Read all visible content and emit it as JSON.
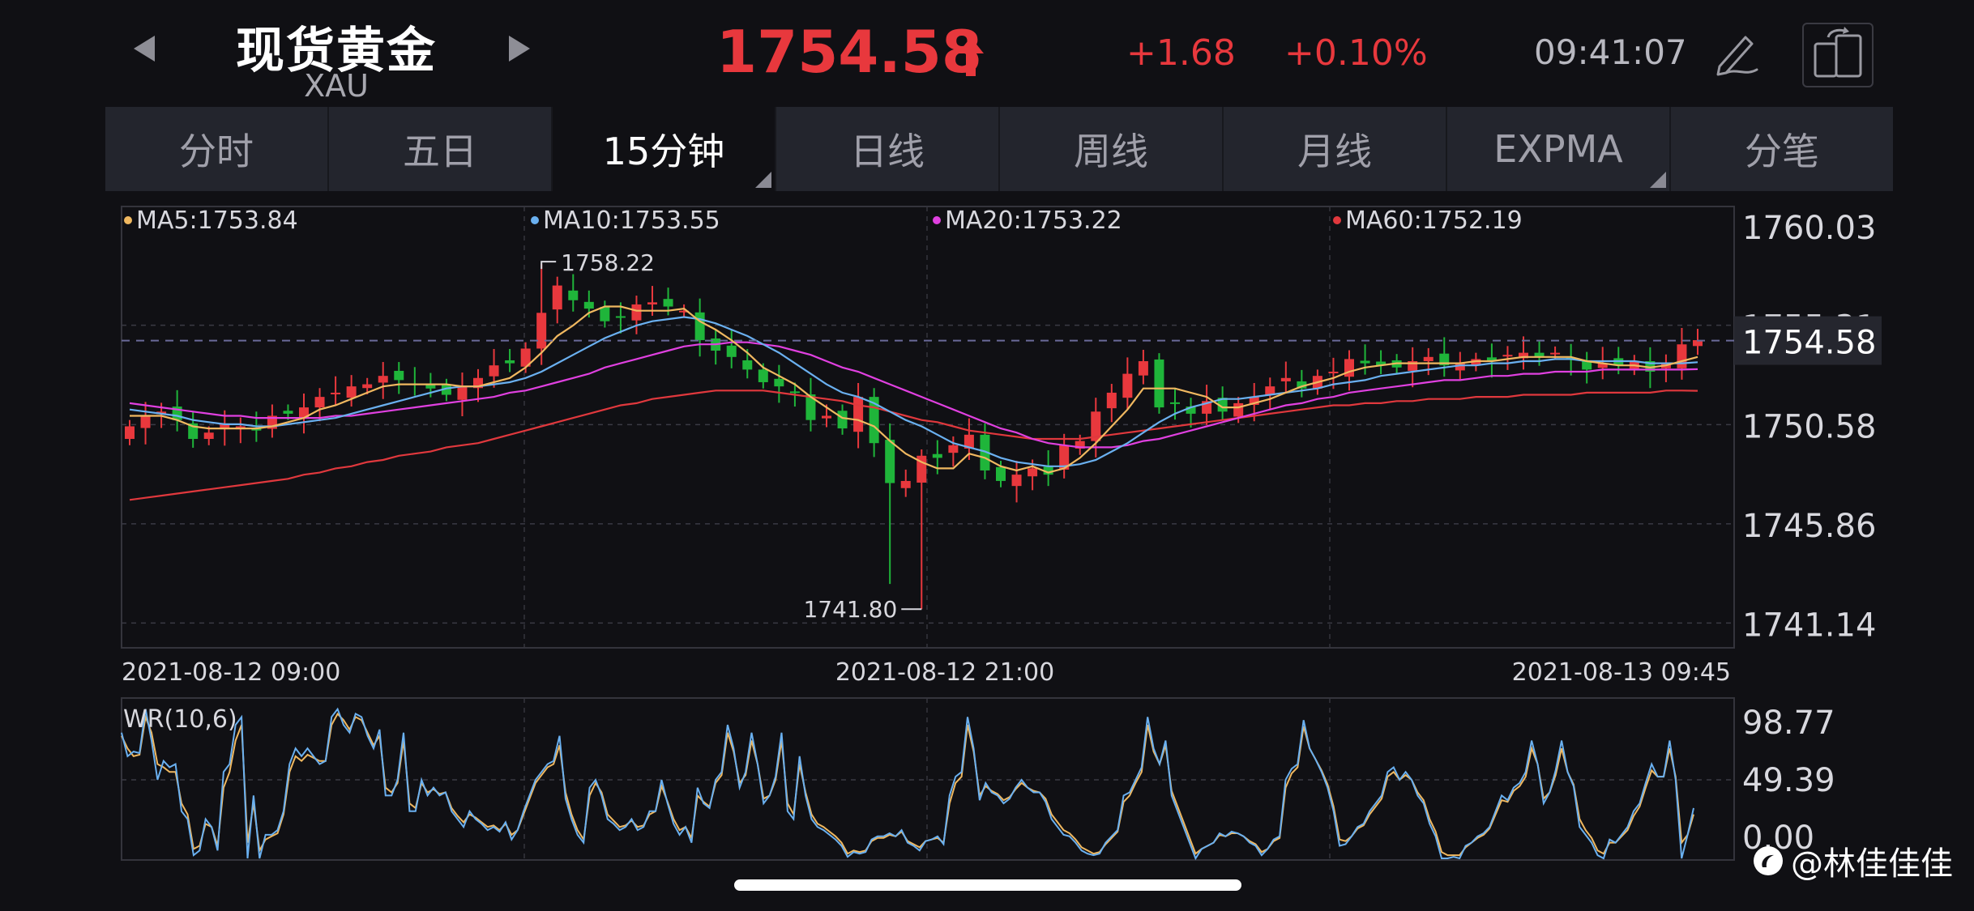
{
  "header": {
    "title": "现货黄金",
    "subtitle": "XAU",
    "price": "1754.58",
    "change": "+1.68",
    "change_pct": "+0.10%",
    "time": "09:41:07"
  },
  "tabs": [
    {
      "label": "分时",
      "active": false,
      "corner": false
    },
    {
      "label": "五日",
      "active": false,
      "corner": false
    },
    {
      "label": "15分钟",
      "active": true,
      "corner": true
    },
    {
      "label": "日线",
      "active": false,
      "corner": false
    },
    {
      "label": "周线",
      "active": false,
      "corner": false
    },
    {
      "label": "月线",
      "active": false,
      "corner": false
    },
    {
      "label": "EXPMA",
      "active": false,
      "corner": true
    },
    {
      "label": "分笔",
      "active": false,
      "corner": false
    }
  ],
  "colors": {
    "up": "#e8383d",
    "down": "#1fb53a",
    "ma5": "#f0b860",
    "ma10": "#6ab0f0",
    "ma20": "#e040e0",
    "ma60": "#e0383d",
    "wr1": "#6ab0f0",
    "wr2": "#f0b860"
  },
  "watermark": "@林佳佳佳",
  "chart_data": [
    {
      "type": "candlestick",
      "legend": [
        {
          "label": "MA5:1753.84",
          "color_key": "ma5"
        },
        {
          "label": "MA10:1753.55",
          "color_key": "ma10"
        },
        {
          "label": "MA20:1753.22",
          "color_key": "ma20"
        },
        {
          "label": "MA60:1752.19",
          "color_key": "ma60"
        }
      ],
      "y_ticks": [
        "1760.03",
        "1755.31",
        "1750.58",
        "1745.86",
        "1741.14"
      ],
      "ylim": [
        1741.14,
        1760.03
      ],
      "current_price_label": "1754.58",
      "current_price": 1754.58,
      "x_labels": [
        "2021-08-12 09:00",
        "2021-08-12 21:00",
        "2021-08-13 09:45"
      ],
      "annotations": [
        {
          "label": "1758.22",
          "value": 1758.22,
          "index": 26
        },
        {
          "label": "1741.80",
          "value": 1741.8,
          "index": 50
        }
      ],
      "series_close": [
        1750.5,
        1751.0,
        1751.2,
        1750.8,
        1749.9,
        1750.2,
        1750.6,
        1750.5,
        1750.3,
        1751.0,
        1751.1,
        1751.4,
        1751.9,
        1752.1,
        1752.4,
        1752.5,
        1752.9,
        1752.7,
        1752.5,
        1752.3,
        1752.0,
        1752.4,
        1752.8,
        1753.4,
        1753.5,
        1754.2,
        1755.9,
        1757.2,
        1756.5,
        1756.1,
        1755.5,
        1755.7,
        1756.3,
        1756.4,
        1756.2,
        1756.0,
        1754.6,
        1754.1,
        1753.8,
        1753.2,
        1752.6,
        1752.4,
        1752.1,
        1750.8,
        1751.0,
        1750.4,
        1751.9,
        1749.7,
        1747.8,
        1747.9,
        1749.1,
        1749.0,
        1749.6,
        1750.1,
        1748.4,
        1747.9,
        1748.2,
        1748.5,
        1748.2,
        1749.6,
        1749.8,
        1751.2,
        1752.1,
        1753.0,
        1753.6,
        1751.4,
        1751.6,
        1751.1,
        1751.7,
        1751.2,
        1751.6,
        1751.9,
        1752.4,
        1752.8,
        1752.3,
        1752.9,
        1753.1,
        1753.7,
        1753.5,
        1753.4,
        1753.3,
        1753.6,
        1753.8,
        1753.4,
        1753.5,
        1753.7,
        1753.6,
        1753.9,
        1754.0,
        1753.8,
        1754.0,
        1753.7,
        1753.2,
        1753.5,
        1753.4,
        1753.6,
        1753.1,
        1753.5,
        1754.4,
        1754.6
      ],
      "series_ma5": [
        1751.0,
        1751.0,
        1751.0,
        1750.8,
        1750.5,
        1750.4,
        1750.4,
        1750.4,
        1750.4,
        1750.5,
        1750.7,
        1750.9,
        1751.3,
        1751.5,
        1751.8,
        1752.1,
        1752.4,
        1752.5,
        1752.5,
        1752.5,
        1752.5,
        1752.4,
        1752.4,
        1752.6,
        1752.8,
        1753.3,
        1754.0,
        1754.8,
        1755.3,
        1755.9,
        1756.2,
        1756.2,
        1756.0,
        1756.0,
        1756.0,
        1756.1,
        1755.5,
        1755.1,
        1754.6,
        1754.0,
        1753.3,
        1752.9,
        1752.5,
        1751.9,
        1751.4,
        1750.9,
        1750.8,
        1750.5,
        1749.8,
        1749.2,
        1748.8,
        1748.5,
        1748.5,
        1749.2,
        1749.0,
        1748.6,
        1748.4,
        1748.6,
        1748.3,
        1748.5,
        1749.0,
        1749.7,
        1750.5,
        1751.3,
        1752.3,
        1752.3,
        1752.3,
        1752.1,
        1751.9,
        1751.4,
        1751.4,
        1751.6,
        1751.8,
        1752.1,
        1752.4,
        1752.6,
        1752.8,
        1753.1,
        1753.3,
        1753.4,
        1753.5,
        1753.5,
        1753.5,
        1753.5,
        1753.5,
        1753.6,
        1753.6,
        1753.7,
        1753.8,
        1753.8,
        1753.8,
        1753.8,
        1753.6,
        1753.5,
        1753.4,
        1753.4,
        1753.3,
        1753.4,
        1753.6,
        1753.8
      ],
      "series_ma10": [
        1751.3,
        1751.2,
        1751.1,
        1751.0,
        1750.8,
        1750.7,
        1750.6,
        1750.6,
        1750.5,
        1750.5,
        1750.6,
        1750.7,
        1750.8,
        1750.9,
        1751.1,
        1751.3,
        1751.5,
        1751.7,
        1751.9,
        1752.1,
        1752.3,
        1752.4,
        1752.4,
        1752.5,
        1752.6,
        1752.8,
        1753.1,
        1753.5,
        1753.9,
        1754.3,
        1754.7,
        1755.0,
        1755.3,
        1755.5,
        1755.6,
        1755.7,
        1755.6,
        1755.4,
        1755.1,
        1754.8,
        1754.4,
        1754.0,
        1753.5,
        1753.0,
        1752.5,
        1752.1,
        1751.9,
        1751.6,
        1751.2,
        1750.8,
        1750.5,
        1750.1,
        1749.7,
        1749.5,
        1749.3,
        1749.0,
        1748.8,
        1748.7,
        1748.6,
        1748.6,
        1748.7,
        1748.9,
        1749.3,
        1749.7,
        1750.2,
        1750.7,
        1751.1,
        1751.4,
        1751.6,
        1751.8,
        1751.8,
        1751.9,
        1752.0,
        1752.1,
        1752.2,
        1752.3,
        1752.5,
        1752.6,
        1752.7,
        1752.9,
        1753.0,
        1753.1,
        1753.2,
        1753.3,
        1753.4,
        1753.4,
        1753.5,
        1753.5,
        1753.6,
        1753.6,
        1753.7,
        1753.7,
        1753.6,
        1753.6,
        1753.6,
        1753.6,
        1753.5,
        1753.5,
        1753.5,
        1753.55
      ],
      "series_ma20": [
        1751.6,
        1751.5,
        1751.4,
        1751.3,
        1751.2,
        1751.1,
        1751.0,
        1751.0,
        1750.9,
        1750.9,
        1750.9,
        1750.9,
        1750.9,
        1751.0,
        1751.0,
        1751.1,
        1751.2,
        1751.3,
        1751.4,
        1751.5,
        1751.6,
        1751.7,
        1751.8,
        1751.9,
        1752.1,
        1752.2,
        1752.4,
        1752.6,
        1752.8,
        1753.0,
        1753.3,
        1753.5,
        1753.7,
        1753.9,
        1754.1,
        1754.3,
        1754.4,
        1754.4,
        1754.5,
        1754.5,
        1754.4,
        1754.3,
        1754.1,
        1753.9,
        1753.6,
        1753.3,
        1753.1,
        1752.8,
        1752.5,
        1752.2,
        1751.9,
        1751.6,
        1751.3,
        1751.0,
        1750.7,
        1750.4,
        1750.2,
        1749.9,
        1749.7,
        1749.6,
        1749.5,
        1749.5,
        1749.5,
        1749.6,
        1749.8,
        1749.9,
        1750.1,
        1750.3,
        1750.5,
        1750.7,
        1750.9,
        1751.1,
        1751.3,
        1751.5,
        1751.6,
        1751.8,
        1751.9,
        1752.1,
        1752.2,
        1752.3,
        1752.4,
        1752.5,
        1752.6,
        1752.7,
        1752.7,
        1752.8,
        1752.9,
        1752.9,
        1753.0,
        1753.0,
        1753.1,
        1753.1,
        1753.1,
        1753.2,
        1753.2,
        1753.2,
        1753.2,
        1753.2,
        1753.2,
        1753.22
      ],
      "series_ma60": [
        1747.0,
        1747.1,
        1747.2,
        1747.3,
        1747.4,
        1747.5,
        1747.6,
        1747.7,
        1747.8,
        1747.9,
        1748.0,
        1748.2,
        1748.3,
        1748.5,
        1748.6,
        1748.8,
        1748.9,
        1749.1,
        1749.2,
        1749.3,
        1749.5,
        1749.6,
        1749.7,
        1749.9,
        1750.1,
        1750.3,
        1750.5,
        1750.7,
        1750.9,
        1751.1,
        1751.3,
        1751.5,
        1751.6,
        1751.8,
        1751.9,
        1752.0,
        1752.1,
        1752.2,
        1752.2,
        1752.2,
        1752.2,
        1752.1,
        1752.0,
        1751.9,
        1751.8,
        1751.7,
        1751.5,
        1751.4,
        1751.2,
        1751.0,
        1750.8,
        1750.7,
        1750.5,
        1750.3,
        1750.2,
        1750.1,
        1750.0,
        1749.9,
        1749.9,
        1749.9,
        1749.9,
        1750.0,
        1750.1,
        1750.2,
        1750.3,
        1750.4,
        1750.5,
        1750.6,
        1750.7,
        1750.8,
        1750.9,
        1751.0,
        1751.1,
        1751.2,
        1751.3,
        1751.4,
        1751.5,
        1751.5,
        1751.6,
        1751.6,
        1751.7,
        1751.7,
        1751.8,
        1751.8,
        1751.8,
        1751.9,
        1751.9,
        1751.9,
        1752.0,
        1752.0,
        1752.0,
        1752.0,
        1752.1,
        1752.1,
        1752.1,
        1752.1,
        1752.1,
        1752.2,
        1752.2,
        1752.19
      ]
    },
    {
      "type": "line",
      "legend_label": "WR(10,6)",
      "y_ticks": [
        "98.77",
        "49.39",
        "0.00"
      ],
      "ylim": [
        0,
        98.77
      ],
      "series": [
        {
          "color_key": "wr1",
          "values": [
            80,
            65,
            68,
            67,
            95,
            75,
            50,
            62,
            58,
            60,
            30,
            25,
            2,
            5,
            25,
            20,
            5,
            55,
            60,
            85,
            90,
            0,
            40,
            0,
            15,
            15,
            18,
            30,
            60,
            70,
            65,
            70,
            65,
            60,
            62,
            90,
            95,
            85,
            80,
            92,
            90,
            78,
            70,
            82,
            40,
            40,
            50,
            80,
            30,
            30,
            50,
            40,
            45,
            40,
            42,
            30,
            25,
            20,
            30,
            25,
            22,
            18,
            20,
            17,
            23,
            12,
            18,
            30,
            40,
            50,
            55,
            60,
            62,
            78,
            38,
            25,
            15,
            10,
            45,
            50,
            40,
            25,
            22,
            18,
            20,
            25,
            18,
            20,
            30,
            30,
            50,
            35,
            22,
            15,
            20,
            10,
            45,
            35,
            32,
            50,
            55,
            85,
            70,
            45,
            55,
            80,
            60,
            35,
            40,
            52,
            80,
            30,
            25,
            65,
            40,
            25,
            20,
            18,
            15,
            12,
            8,
            1,
            4,
            3,
            4,
            12,
            14,
            14,
            16,
            14,
            18,
            10,
            8,
            5,
            11,
            12,
            14,
            9,
            40,
            52,
            55,
            90,
            70,
            37,
            48,
            42,
            40,
            35,
            38,
            45,
            50,
            45,
            42,
            42,
            36,
            25,
            20,
            15,
            14,
            10,
            5,
            3,
            2,
            3,
            10,
            14,
            18,
            40,
            42,
            50,
            58,
            90,
            70,
            60,
            75,
            40,
            30,
            20,
            10,
            0,
            6,
            8,
            10,
            16,
            14,
            17,
            16,
            14,
            10,
            8,
            2,
            6,
            12,
            14,
            50,
            57,
            60,
            88,
            70,
            63,
            55,
            45,
            30,
            8,
            9,
            14,
            20,
            22,
            30,
            35,
            40,
            55,
            58,
            50,
            55,
            50,
            40,
            35,
            22,
            14,
            0,
            0,
            1,
            0,
            8,
            10,
            14,
            16,
            20,
            30,
            40,
            37,
            45,
            48,
            55,
            75,
            60,
            35,
            42,
            56,
            75,
            55,
            46,
            20,
            15,
            10,
            2,
            0,
            12,
            10,
            15,
            20,
            30,
            35,
            48,
            60,
            52,
            52,
            75,
            50,
            0,
            15,
            32
          ]
        },
        {
          "color_key": "wr2",
          "values": [
            78,
            70,
            65,
            66,
            90,
            80,
            60,
            58,
            55,
            55,
            35,
            28,
            6,
            8,
            22,
            20,
            8,
            45,
            55,
            75,
            85,
            10,
            35,
            5,
            12,
            14,
            16,
            28,
            55,
            65,
            62,
            66,
            64,
            62,
            62,
            85,
            92,
            88,
            82,
            90,
            88,
            80,
            72,
            78,
            45,
            42,
            48,
            75,
            35,
            32,
            48,
            42,
            44,
            41,
            42,
            32,
            27,
            23,
            28,
            26,
            23,
            20,
            21,
            18,
            22,
            15,
            18,
            28,
            38,
            48,
            53,
            58,
            60,
            72,
            42,
            28,
            18,
            12,
            40,
            48,
            42,
            28,
            24,
            20,
            21,
            24,
            20,
            21,
            28,
            30,
            46,
            36,
            25,
            18,
            20,
            13,
            40,
            36,
            33,
            48,
            53,
            80,
            68,
            48,
            53,
            75,
            60,
            38,
            40,
            50,
            75,
            35,
            28,
            60,
            42,
            28,
            22,
            20,
            17,
            14,
            10,
            3,
            5,
            4,
            5,
            11,
            13,
            13,
            15,
            14,
            17,
            11,
            9,
            7,
            11,
            12,
            13,
            10,
            35,
            48,
            52,
            85,
            68,
            40,
            46,
            43,
            41,
            37,
            39,
            44,
            48,
            45,
            43,
            42,
            38,
            28,
            23,
            18,
            16,
            12,
            7,
            5,
            3,
            4,
            9,
            13,
            17,
            36,
            40,
            48,
            55,
            85,
            68,
            60,
            72,
            43,
            33,
            23,
            13,
            3,
            6,
            8,
            10,
            15,
            14,
            16,
            16,
            14,
            11,
            9,
            4,
            6,
            11,
            13,
            45,
            54,
            58,
            84,
            70,
            63,
            56,
            47,
            33,
            12,
            11,
            14,
            19,
            21,
            28,
            33,
            38,
            52,
            55,
            50,
            53,
            50,
            42,
            37,
            25,
            17,
            4,
            2,
            2,
            2,
            7,
            10,
            13,
            15,
            19,
            28,
            37,
            36,
            43,
            46,
            52,
            70,
            60,
            38,
            42,
            53,
            70,
            55,
            47,
            25,
            18,
            13,
            5,
            3,
            10,
            10,
            14,
            18,
            27,
            33,
            45,
            56,
            52,
            52,
            70,
            52,
            10,
            15,
            28
          ]
        }
      ]
    }
  ]
}
